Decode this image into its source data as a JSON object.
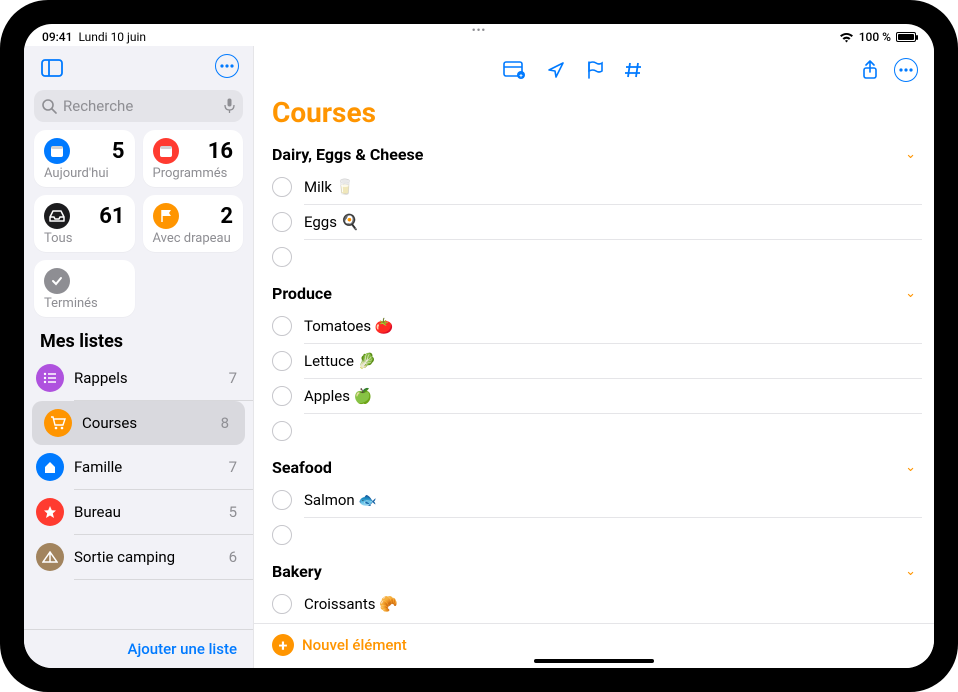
{
  "status": {
    "time": "09:41",
    "date": "Lundi 10 juin",
    "battery": "100 %",
    "wifi": "wifi"
  },
  "sidebar": {
    "search_placeholder": "Recherche",
    "smart": [
      {
        "label": "Aujourd'hui",
        "count": 5,
        "color": "#007aff",
        "icon": "calendar"
      },
      {
        "label": "Programmés",
        "count": 16,
        "color": "#ff3b30",
        "icon": "calendar"
      },
      {
        "label": "Tous",
        "count": 61,
        "color": "#1c1c1e",
        "icon": "tray"
      },
      {
        "label": "Avec drapeau",
        "count": 2,
        "color": "#ff9500",
        "icon": "flag"
      },
      {
        "label": "Terminés",
        "count": "",
        "color": "#8e8e93",
        "icon": "check",
        "wide": false
      }
    ],
    "lists_header": "Mes listes",
    "lists": [
      {
        "name": "Rappels",
        "count": 7,
        "color": "#af52de",
        "icon": "list"
      },
      {
        "name": "Courses",
        "count": 8,
        "color": "#ff9500",
        "icon": "cart",
        "selected": true
      },
      {
        "name": "Famille",
        "count": 7,
        "color": "#007aff",
        "icon": "house"
      },
      {
        "name": "Bureau",
        "count": 5,
        "color": "#ff3b30",
        "icon": "star"
      },
      {
        "name": "Sortie camping",
        "count": 6,
        "color": "#a2845e",
        "icon": "tent"
      }
    ],
    "add_list_label": "Ajouter une liste"
  },
  "main": {
    "title": "Courses",
    "sections": [
      {
        "title": "Dairy, Eggs & Cheese",
        "items": [
          "Milk 🥛",
          "Eggs 🍳",
          ""
        ]
      },
      {
        "title": "Produce",
        "items": [
          "Tomatoes 🍅",
          "Lettuce 🥬",
          "Apples 🍏",
          ""
        ]
      },
      {
        "title": "Seafood",
        "items": [
          "Salmon 🐟",
          ""
        ]
      },
      {
        "title": "Bakery",
        "items": [
          "Croissants 🥐"
        ]
      }
    ],
    "new_item_label": "Nouvel élément"
  }
}
